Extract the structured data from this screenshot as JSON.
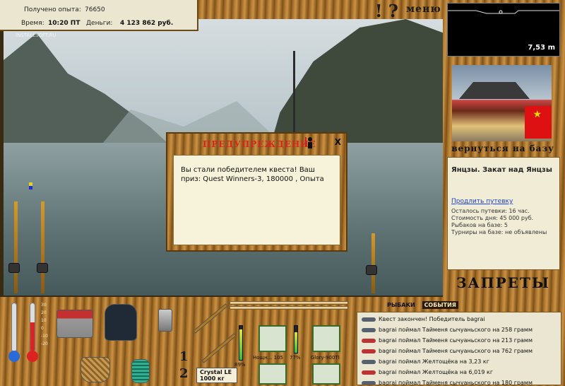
{
  "info": {
    "experience_label": "Получено опыта:",
    "experience_value": "76650",
    "time_label": "Время:",
    "time_value": "10:20 ПТ",
    "money_label": "Деньги:",
    "money_value": "4 123 862 руб.",
    "watermark": "INSTALLSOFT.RU"
  },
  "topbar": {
    "help_symbols": "! ?",
    "menu_label": "меню"
  },
  "depth": {
    "value": "7,53 m"
  },
  "location": {
    "return_button": "вернуться на базу",
    "title": "Янцзы. Закат над Янцзы",
    "extend_link": "Продлить путевку",
    "lines": [
      "Осталось путевки: 16 час.",
      "Стоимость дня: 45 000 руб.",
      "Рыбаков на базе: 5",
      "Турниры на базе: не объявлены"
    ],
    "bans_button": "ЗАПРЕТЫ"
  },
  "modal": {
    "title": "ПРЕДУПРЕЖДЕНИЕ",
    "close": "X",
    "message": "Вы стали победителем квеста! Ваш приз: Quest Winners-3, 180000 , Опыта"
  },
  "thermo": {
    "ticks": [
      "30",
      "20",
      "10",
      "0",
      "-10",
      "-20"
    ]
  },
  "gear": {
    "slot_numbers": [
      "1",
      "2"
    ],
    "rod_name": "Crystal LE",
    "rod_load": "1000 кг",
    "rod_percent": "89%",
    "reel_caption": "Нощн... 105",
    "line_percent": "77%",
    "lure_caption": "Glory-900TI"
  },
  "tabs": {
    "fishermen": "РЫБАКИ",
    "events": "СОБЫТИЯ"
  },
  "log": [
    {
      "text": "Квест закончен! Победитель bagrai",
      "red": false
    },
    {
      "text": "bagrai поймал Тайменя сычуаньского на 258 грамм",
      "red": false
    },
    {
      "text": "bagrai поймал Тайменя сычуаньского на 213 грамм",
      "red": true
    },
    {
      "text": "bagrai поймал Тайменя сычуаньского на 762 грамм",
      "red": true
    },
    {
      "text": "bagrai поймал Желтощёка на 3,23 кг",
      "red": false
    },
    {
      "text": "bagrai поймал Желтощёка на 6,019 кг",
      "red": true
    },
    {
      "text": "bagrai поймал Тайменя сычуаньского на 180 грамм",
      "red": false
    }
  ],
  "colors": {
    "modal_title": "#d3271c",
    "link": "#1b3fd0",
    "panel_bg": "#f0ecd6"
  }
}
